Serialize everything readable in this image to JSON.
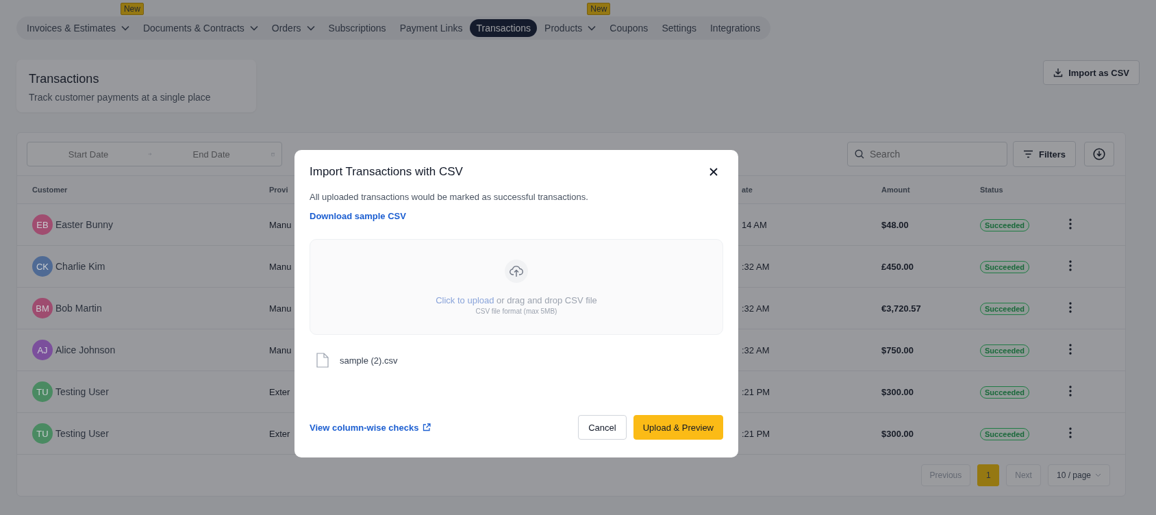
{
  "nav": {
    "items": [
      {
        "label": "Invoices & Estimates",
        "dropdown": true,
        "badge": "New",
        "selected": false
      },
      {
        "label": "Documents & Contracts",
        "dropdown": true,
        "selected": false
      },
      {
        "label": "Orders",
        "dropdown": true,
        "selected": false
      },
      {
        "label": "Subscriptions",
        "dropdown": false,
        "selected": false
      },
      {
        "label": "Payment Links",
        "dropdown": false,
        "selected": false
      },
      {
        "label": "Transactions",
        "dropdown": false,
        "selected": true
      },
      {
        "label": "Products",
        "dropdown": true,
        "badge": "New",
        "selected": false
      },
      {
        "label": "Coupons",
        "dropdown": false,
        "selected": false
      },
      {
        "label": "Settings",
        "dropdown": false,
        "selected": false
      },
      {
        "label": "Integrations",
        "dropdown": false,
        "selected": false
      }
    ]
  },
  "header": {
    "title": "Transactions",
    "subtitle": "Track customer payments at a single place"
  },
  "import_button": "Import as CSV",
  "toolbar": {
    "start_placeholder": "Start Date",
    "end_placeholder": "End Date",
    "search_placeholder": "Search",
    "filters": "Filters"
  },
  "table": {
    "columns": [
      "Customer",
      "Provi",
      "ate",
      "Amount",
      "Status"
    ],
    "rows": [
      {
        "initials": "EB",
        "customer": "Easter Bunny",
        "color": "#a04d70",
        "provider": "Manu",
        "date": "14 AM",
        "amount": "$48.00",
        "status": "Succeeded"
      },
      {
        "initials": "CK",
        "customer": "Charlie Kim",
        "color": "#4f6a94",
        "provider": "Manu",
        "date": ":32 AM",
        "amount": "£450.00",
        "status": "Succeeded"
      },
      {
        "initials": "BM",
        "customer": "Bob Martin",
        "color": "#9e4c6f",
        "provider": "Manu",
        "date": ":32 AM",
        "amount": "€3,720.57",
        "status": "Succeeded"
      },
      {
        "initials": "AJ",
        "customer": "Alice Johnson",
        "color": "#7b4f9c",
        "provider": "Manu",
        "date": ":32 AM",
        "amount": "$750.00",
        "status": "Succeeded"
      },
      {
        "initials": "TU",
        "customer": "Testing User",
        "color": "#4a8a62",
        "provider": "Exter",
        "date": ":21 PM",
        "amount": "$300.00",
        "status": "Succeeded"
      },
      {
        "initials": "TU",
        "customer": "Testing User",
        "color": "#4a8a62",
        "provider": "Exter",
        "date": ":21 PM",
        "amount": "$300.00",
        "status": "Succeeded"
      }
    ]
  },
  "pagination": {
    "previous": "Previous",
    "pages": [
      {
        "label": "1",
        "selected": true
      }
    ],
    "next": "Next",
    "page_size": "10 / page"
  },
  "modal": {
    "title": "Import Transactions with CSV",
    "description": "All uploaded transactions would be marked as successful transactions.",
    "download_link": "Download sample CSV",
    "upload_link": "Click to upload",
    "upload_text": "or drag and drop CSV file",
    "upload_hint": "CSV file format (max 5MB)",
    "file_name": "sample (2).csv",
    "checks_link": "View column-wise checks",
    "cancel": "Cancel",
    "submit": "Upload & Preview"
  }
}
